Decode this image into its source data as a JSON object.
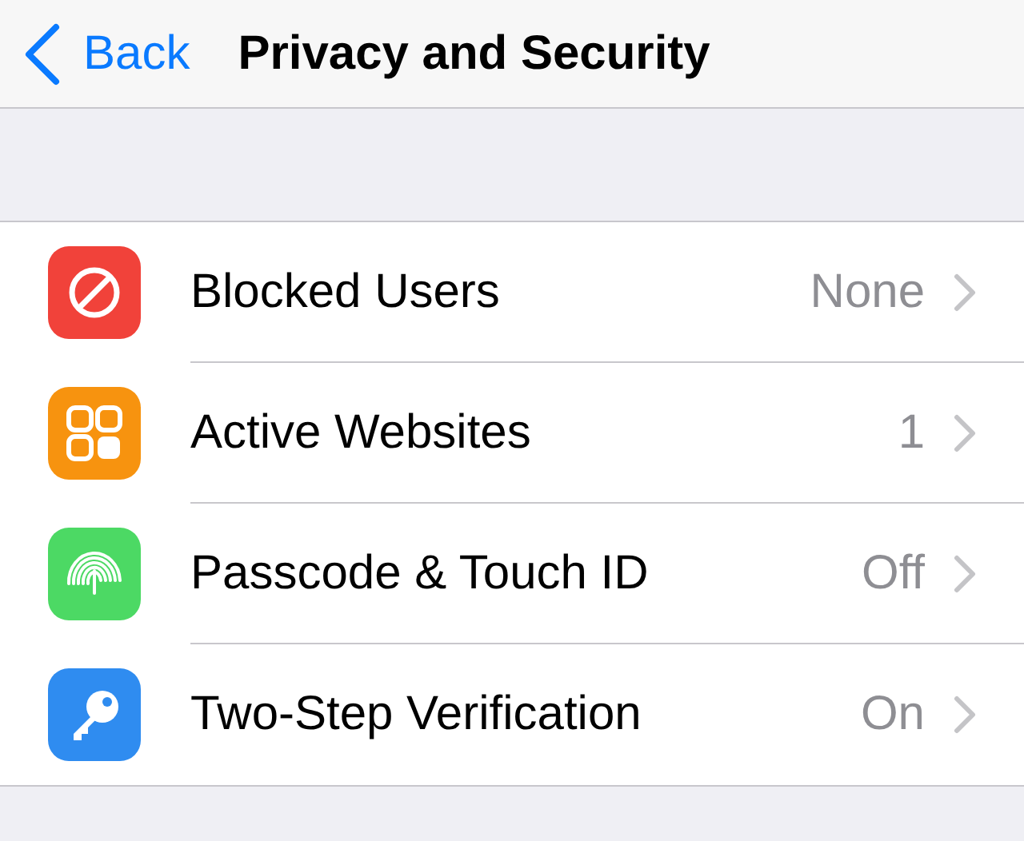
{
  "nav_bar": {
    "back_label": "Back",
    "title": "Privacy and Security"
  },
  "settings": [
    {
      "kind": "blocked",
      "label": "Blocked Users",
      "value": "None",
      "color": "#f1423a"
    },
    {
      "kind": "websites",
      "label": "Active Websites",
      "value": "1",
      "color": "#f7930f"
    },
    {
      "kind": "fingerprint",
      "label": "Passcode & Touch ID",
      "value": "Off",
      "color": "#4cd964"
    },
    {
      "kind": "key",
      "label": "Two-Step Verification",
      "value": "On",
      "color": "#2f8cf0"
    }
  ]
}
